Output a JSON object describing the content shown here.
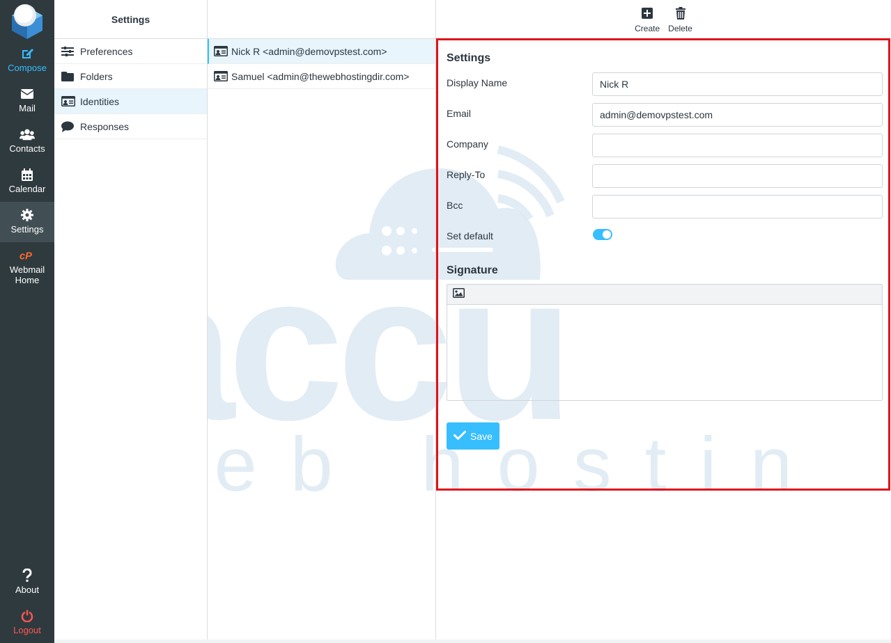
{
  "rail": {
    "items": [
      {
        "label": "Compose",
        "icon": "compose-icon"
      },
      {
        "label": "Mail",
        "icon": "mail-icon"
      },
      {
        "label": "Contacts",
        "icon": "contacts-icon"
      },
      {
        "label": "Calendar",
        "icon": "calendar-icon"
      },
      {
        "label": "Settings",
        "icon": "gear-icon"
      },
      {
        "label": "Webmail Home",
        "icon": "cpanel-icon"
      }
    ],
    "about_label": "About",
    "logout_label": "Logout"
  },
  "settings": {
    "title": "Settings",
    "items": [
      {
        "label": "Preferences",
        "icon": "sliders-icon"
      },
      {
        "label": "Folders",
        "icon": "folder-icon"
      },
      {
        "label": "Identities",
        "icon": "id-card-icon",
        "active": true
      },
      {
        "label": "Responses",
        "icon": "comment-icon"
      }
    ]
  },
  "identities": [
    {
      "label": "Nick R <admin@demovpstest.com>",
      "active": true
    },
    {
      "label": "Samuel <admin@thewebhostingdir.com>",
      "active": false
    }
  ],
  "toolbar": {
    "create_label": "Create",
    "delete_label": "Delete"
  },
  "form": {
    "title": "Settings",
    "display_name_label": "Display Name",
    "display_name_value": "Nick R",
    "email_label": "Email",
    "email_value": "admin@demovpstest.com",
    "company_label": "Company",
    "company_value": "",
    "reply_to_label": "Reply-To",
    "reply_to_value": "",
    "bcc_label": "Bcc",
    "bcc_value": "",
    "set_default_label": "Set default",
    "set_default_on": true,
    "signature_title": "Signature",
    "save_label": "Save"
  },
  "watermark": {
    "brand": "accu",
    "tagline": "web hosting"
  },
  "colors": {
    "accent": "#37beff",
    "rail_bg": "#2f3a3f",
    "highlight_frame": "#e0121b",
    "logout": "#ff5552",
    "cpanel": "#ff6c2c"
  }
}
